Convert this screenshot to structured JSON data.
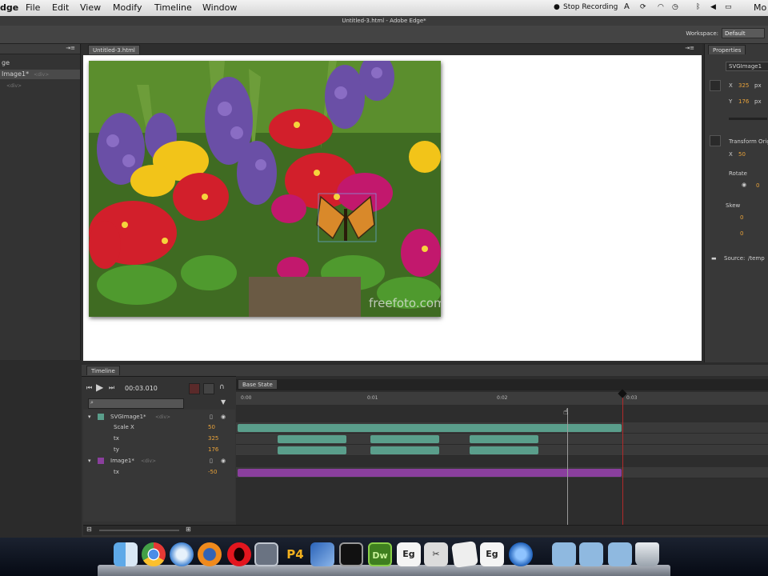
{
  "menubar": {
    "app": "dge",
    "items": [
      "File",
      "Edit",
      "View",
      "Modify",
      "Timeline",
      "Window"
    ],
    "stop_recording": "Stop Recording",
    "user": "Mo"
  },
  "window": {
    "title": "Untitled-3.html - Adobe Edge*"
  },
  "toolbar": {
    "workspace_label": "Workspace:",
    "workspace_value": "Default"
  },
  "elements_panel": {
    "rows": [
      {
        "label": "ge",
        "sub": ""
      },
      {
        "label": "Image1*",
        "sub": "<div>"
      },
      {
        "label": "",
        "sub": "<div>"
      }
    ]
  },
  "stage": {
    "tab": "Untitled-3.html",
    "watermark": "freefoto.com"
  },
  "properties": {
    "tab": "Properties",
    "element_id": "SVGImage1",
    "x_label": "X",
    "x": "325",
    "x_unit": "px",
    "y_label": "Y",
    "y": "176",
    "y_unit": "px",
    "transform": "Transform Origin",
    "tx_label": "X",
    "tx": "50",
    "rotate": "Rotate",
    "rotate_value": "0",
    "skew": "Skew",
    "skew_x": "0",
    "skew_y": "0",
    "source_label": "Source:",
    "source_value": "/temp"
  },
  "timeline": {
    "tab": "Timeline",
    "time": "00:03.010",
    "base_state": "Base State",
    "ruler": [
      "0:00",
      "0:01",
      "0:02",
      "0:03"
    ],
    "layers": [
      {
        "name": "SVGImage1*",
        "sub": "<div>",
        "value": ""
      },
      {
        "name": "Scale X",
        "sub": "",
        "value": "50"
      },
      {
        "name": "tx",
        "sub": "",
        "value": "325"
      },
      {
        "name": "ty",
        "sub": "",
        "value": "176"
      },
      {
        "name": "Image1*",
        "sub": "<div>",
        "value": ""
      },
      {
        "name": "tx",
        "sub": "",
        "value": "-50"
      }
    ]
  },
  "dock": {
    "items": [
      "finder",
      "chrome",
      "safari",
      "firefox",
      "opera",
      "preview",
      "p4",
      "xcode",
      "terminal",
      "Dw",
      "Eg",
      "app",
      "paper",
      "Eg",
      "quicktime",
      "folder",
      "folder",
      "folder",
      "trash"
    ]
  },
  "colors": {
    "accent": "#e8a23a",
    "track_green": "#5a9e8b",
    "track_purple": "#8a3f9d",
    "playhead": "#b02a2a"
  }
}
